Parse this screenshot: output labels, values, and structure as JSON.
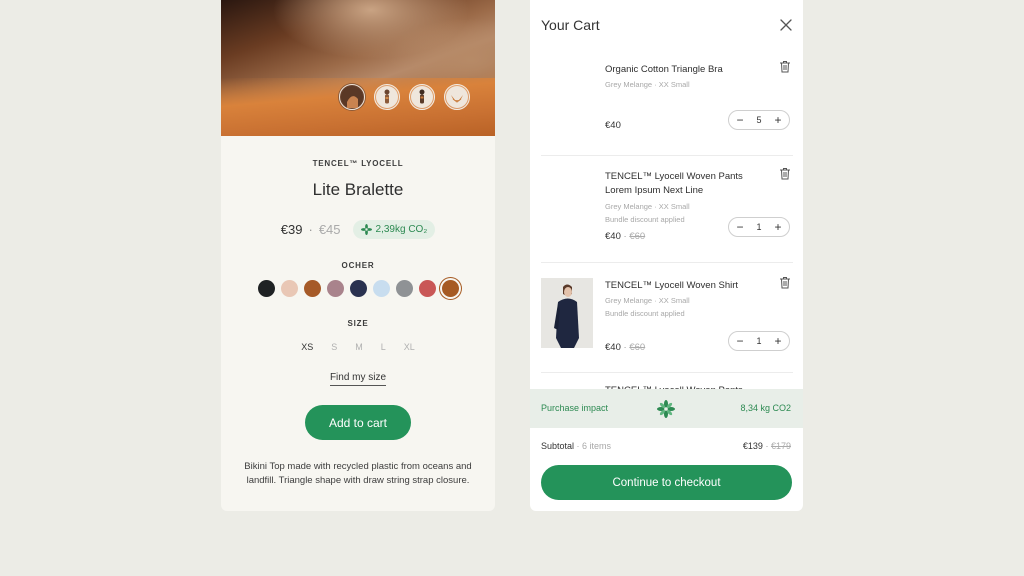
{
  "product": {
    "material": "TENCEL™ LYOCELL",
    "name": "Lite Bralette",
    "price": "€39",
    "price_sep": "·",
    "old_price": "€45",
    "co2": "2,39kg CO₂",
    "color_label": "OCHER",
    "swatches": [
      {
        "name": "black",
        "color": "#1f2224"
      },
      {
        "name": "blush",
        "color": "#e9c7b5"
      },
      {
        "name": "rust",
        "color": "#a65a28"
      },
      {
        "name": "mauve",
        "color": "#a9838c"
      },
      {
        "name": "navy",
        "color": "#2a3250"
      },
      {
        "name": "light-blue",
        "color": "#c8ddef"
      },
      {
        "name": "grey",
        "color": "#8f9295"
      },
      {
        "name": "coral",
        "color": "#c95757"
      },
      {
        "name": "ocher",
        "color": "#a65a22"
      }
    ],
    "size_label": "SIZE",
    "sizes": [
      "XS",
      "S",
      "M",
      "L",
      "XL"
    ],
    "find_size": "Find my size",
    "add_to_cart": "Add to cart",
    "description": "Bikini Top made with recycled plastic from oceans and landfill. Triangle shape with draw string strap closure."
  },
  "cart": {
    "title": "Your Cart",
    "items": [
      {
        "name": "Organic Cotton Triangle Bra",
        "variant": "Grey Melange · XX Small",
        "note": "",
        "price": "€40",
        "old_price": "",
        "qty": "5"
      },
      {
        "name": "TENCEL™ Lyocell Woven Pants Lorem Ipsum Next Line",
        "variant": "Grey Melange · XX Small",
        "note": "Bundle discount applied",
        "price": "€40",
        "old_price": "€60",
        "qty": "1"
      },
      {
        "name": "TENCEL™ Lyocell Woven Shirt",
        "variant": "Grey Melange · XX Small",
        "note": "Bundle discount applied",
        "price": "€40",
        "old_price": "€60",
        "qty": "1"
      },
      {
        "name": "TENCEL™ Lyocell Woven Pants"
      }
    ],
    "impact_label": "Purchase impact",
    "impact_value": "8,34 kg CO2",
    "subtotal_label": "Subtotal",
    "subtotal_count": "6 items",
    "total": "€139",
    "total_old": "€179",
    "checkout": "Continue to checkout"
  },
  "colors": {
    "accent": "#24935a",
    "impact_text": "#2d8a52",
    "impact_bg": "#e8eee8",
    "background": "#ecece6"
  }
}
